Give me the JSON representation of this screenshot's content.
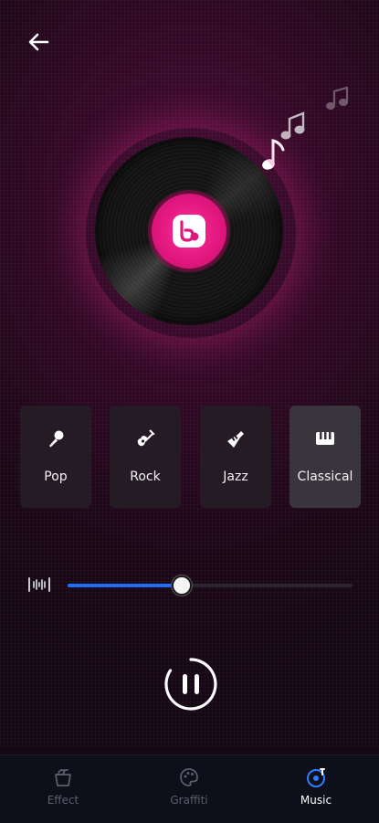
{
  "genres": [
    {
      "label": "Pop",
      "icon": "microphone-icon"
    },
    {
      "label": "Rock",
      "icon": "guitar-icon"
    },
    {
      "label": "Jazz",
      "icon": "trumpet-icon"
    },
    {
      "label": "Classical",
      "icon": "piano-icon",
      "selected": true
    }
  ],
  "volume": {
    "level": 0.4
  },
  "player": {
    "state": "playing"
  },
  "nav": {
    "items": [
      {
        "label": "Effect",
        "icon": "bucket-icon"
      },
      {
        "label": "Graffiti",
        "icon": "palette-icon"
      },
      {
        "label": "Music",
        "icon": "music-disc-icon",
        "active": true
      }
    ]
  },
  "colors": {
    "accent_pink": "#e0177d",
    "slider_blue": "#1f6fff",
    "background": "#2d0823",
    "nav_background": "#0d0f1a"
  }
}
